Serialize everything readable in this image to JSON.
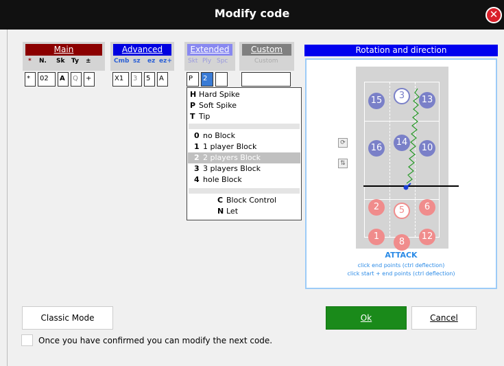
{
  "window": {
    "title": "Modify code"
  },
  "groups": {
    "main": {
      "label": "Main",
      "subs": [
        "*",
        "N.",
        "Sk",
        "Ty",
        "±"
      ],
      "fields": [
        "*",
        "02",
        "A",
        "Q",
        "+"
      ]
    },
    "advanced": {
      "label": "Advanced",
      "subs": [
        "Cmb",
        "sz",
        "ez",
        "ez+"
      ],
      "fields": [
        "X1",
        "3",
        "5",
        "A"
      ]
    },
    "extended": {
      "label": "Extended",
      "subs": [
        "Skt",
        "Ply",
        "Spc"
      ],
      "fields": [
        "P",
        "2",
        ""
      ]
    },
    "custom": {
      "label": "Custom",
      "sub": "Custom",
      "field": ""
    }
  },
  "menu": {
    "items": [
      {
        "key": "H",
        "label": "Hard Spike"
      },
      {
        "key": "P",
        "label": "Soft Spike"
      },
      {
        "key": "T",
        "label": "Tip"
      },
      {
        "key": "0",
        "label": "no Block"
      },
      {
        "key": "1",
        "label": "1 player Block"
      },
      {
        "key": "2",
        "label": "2 players Block"
      },
      {
        "key": "3",
        "label": "3 players Block"
      },
      {
        "key": "4",
        "label": "hole Block"
      },
      {
        "key": "C",
        "label": "Block Control"
      },
      {
        "key": "N",
        "label": "Let"
      }
    ],
    "selected_key": "2"
  },
  "rotation": {
    "header": "Rotation and direction",
    "players_top": [
      "15",
      "3",
      "13",
      "16",
      "14",
      "10"
    ],
    "players_bottom": [
      "2",
      "5",
      "6",
      "1",
      "8",
      "12"
    ],
    "attack_label": "ATTACK",
    "hint1": "click end points (ctrl deflection)",
    "hint2": "click start + end points (ctrl deflection)"
  },
  "buttons": {
    "classic": "Classic Mode",
    "ok": "Ok",
    "cancel": "Cancel"
  },
  "confirm_text": "Once you have confirmed you can modify the next code.",
  "colors": {
    "main": "#8b0000",
    "advanced": "#0000e0",
    "extended": "#8888f0",
    "custom": "#808080",
    "ok": "#1a8a1a",
    "close": "#d9202a"
  }
}
